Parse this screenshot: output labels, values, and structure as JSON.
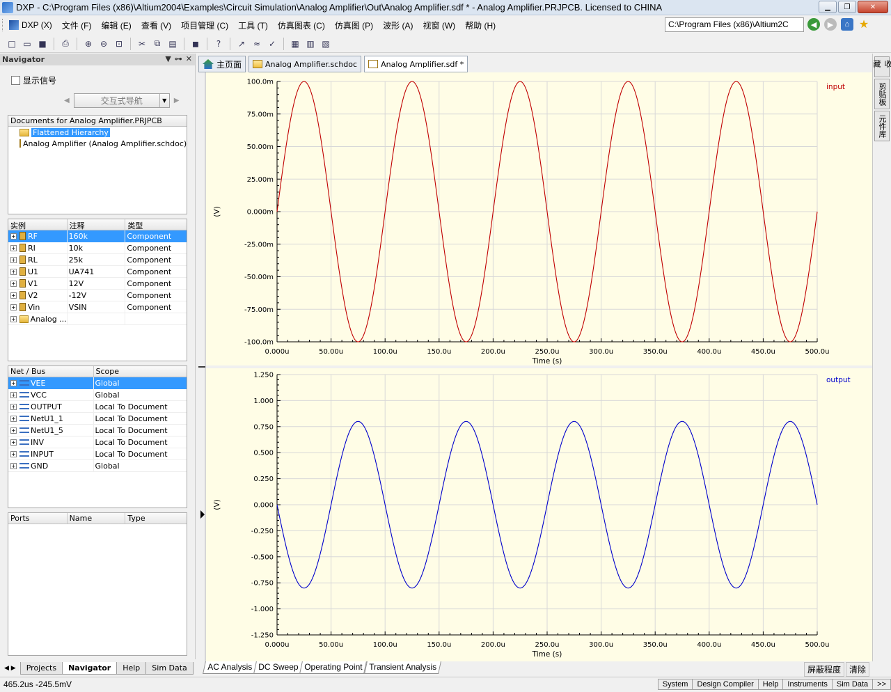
{
  "window": {
    "title": "DXP - C:\\Program Files (x86)\\Altium2004\\Examples\\Circuit Simulation\\Analog Amplifier\\Out\\Analog Amplifier.sdf * - Analog Amplifier.PRJPCB. Licensed to CHINA"
  },
  "menu": {
    "items": [
      "DXP (X)",
      "文件 (F)",
      "编辑 (E)",
      "查看 (V)",
      "项目管理 (C)",
      "工具 (T)",
      "仿真图表 (C)",
      "仿真图 (P)",
      "波形 (A)",
      "视窗 (W)",
      "帮助 (H)"
    ],
    "path": "C:\\Program Files (x86)\\Altium2C"
  },
  "navigator": {
    "title": "Navigator",
    "show_signals": "显示信号",
    "interactive_nav": "交互式导航",
    "documents_header": "Documents for Analog Amplifier.PRJPCB",
    "documents": [
      "Flattened Hierarchy",
      "Analog Amplifier (Analog Amplifier.schdoc)"
    ],
    "instances_headers": [
      "实例",
      "注释",
      "类型"
    ],
    "instances": [
      {
        "name": "RF",
        "comment": "160k",
        "type": "Component"
      },
      {
        "name": "RI",
        "comment": "10k",
        "type": "Component"
      },
      {
        "name": "RL",
        "comment": "25k",
        "type": "Component"
      },
      {
        "name": "U1",
        "comment": "UA741",
        "type": "Component"
      },
      {
        "name": "V1",
        "comment": "12V",
        "type": "Component"
      },
      {
        "name": "V2",
        "comment": "-12V",
        "type": "Component"
      },
      {
        "name": "Vin",
        "comment": "VSIN",
        "type": "Component"
      },
      {
        "name": "Analog ...",
        "comment": "",
        "type": ""
      }
    ],
    "nets_headers": [
      "Net / Bus",
      "Scope"
    ],
    "nets": [
      {
        "name": "VEE",
        "scope": "Global"
      },
      {
        "name": "VCC",
        "scope": "Global"
      },
      {
        "name": "OUTPUT",
        "scope": "Local To Document"
      },
      {
        "name": "NetU1_1",
        "scope": "Local To Document"
      },
      {
        "name": "NetU1_5",
        "scope": "Local To Document"
      },
      {
        "name": "INV",
        "scope": "Local To Document"
      },
      {
        "name": "INPUT",
        "scope": "Local To Document"
      },
      {
        "name": "GND",
        "scope": "Global"
      }
    ],
    "ports_headers": [
      "Ports",
      "Name",
      "Type"
    ],
    "tabs": [
      "Projects",
      "Navigator",
      "Help",
      "Sim Data"
    ]
  },
  "doc_tabs": [
    "主页面",
    "Analog Amplifier.schdoc",
    "Analog Amplifier.sdf *"
  ],
  "right_tabs": [
    "收藏",
    "剪贴板",
    "元件库"
  ],
  "chart_data": [
    {
      "type": "line",
      "series": [
        {
          "name": "input",
          "color": "#c00000",
          "amplitude": 0.1,
          "period_us": 100,
          "phase": "sin"
        }
      ],
      "x_range_us": [
        0,
        500
      ],
      "xticks": [
        "0.000u",
        "50.00u",
        "100.0u",
        "150.0u",
        "200.0u",
        "250.0u",
        "300.0u",
        "350.0u",
        "400.0u",
        "450.0u",
        "500.0u"
      ],
      "ylim": [
        -0.1,
        0.1
      ],
      "yticks": [
        "100.0m",
        "75.00m",
        "50.00m",
        "25.00m",
        "0.000m",
        "-25.00m",
        "-50.00m",
        "-75.00m",
        "-100.0m"
      ],
      "xlabel": "Time (s)",
      "ylabel": "(V)",
      "grid": true
    },
    {
      "type": "line",
      "series": [
        {
          "name": "output",
          "color": "#0000cc",
          "amplitude": 0.8,
          "period_us": 100,
          "phase": "-sin"
        }
      ],
      "x_range_us": [
        0,
        500
      ],
      "xticks": [
        "0.000u",
        "50.00u",
        "100.0u",
        "150.0u",
        "200.0u",
        "250.0u",
        "300.0u",
        "350.0u",
        "400.0u",
        "450.0u",
        "500.0u"
      ],
      "ylim": [
        -1.25,
        1.25
      ],
      "yticks": [
        "1.250",
        "1.000",
        "0.750",
        "0.500",
        "0.250",
        "0.000",
        "-0.250",
        "-0.500",
        "-0.750",
        "-1.000",
        "-1.250"
      ],
      "xlabel": "Time (s)",
      "ylabel": "(V)",
      "grid": true
    }
  ],
  "sim_tabs": [
    "AC Analysis",
    "DC Sweep",
    "Operating Point",
    "Transient Analysis"
  ],
  "sim_buttons": [
    "屏蔽程度",
    "清除"
  ],
  "status": {
    "coord": "465.2us -245.5mV",
    "tabs": [
      "System",
      "Design Compiler",
      "Help",
      "Instruments",
      "Sim Data",
      ">>"
    ]
  }
}
